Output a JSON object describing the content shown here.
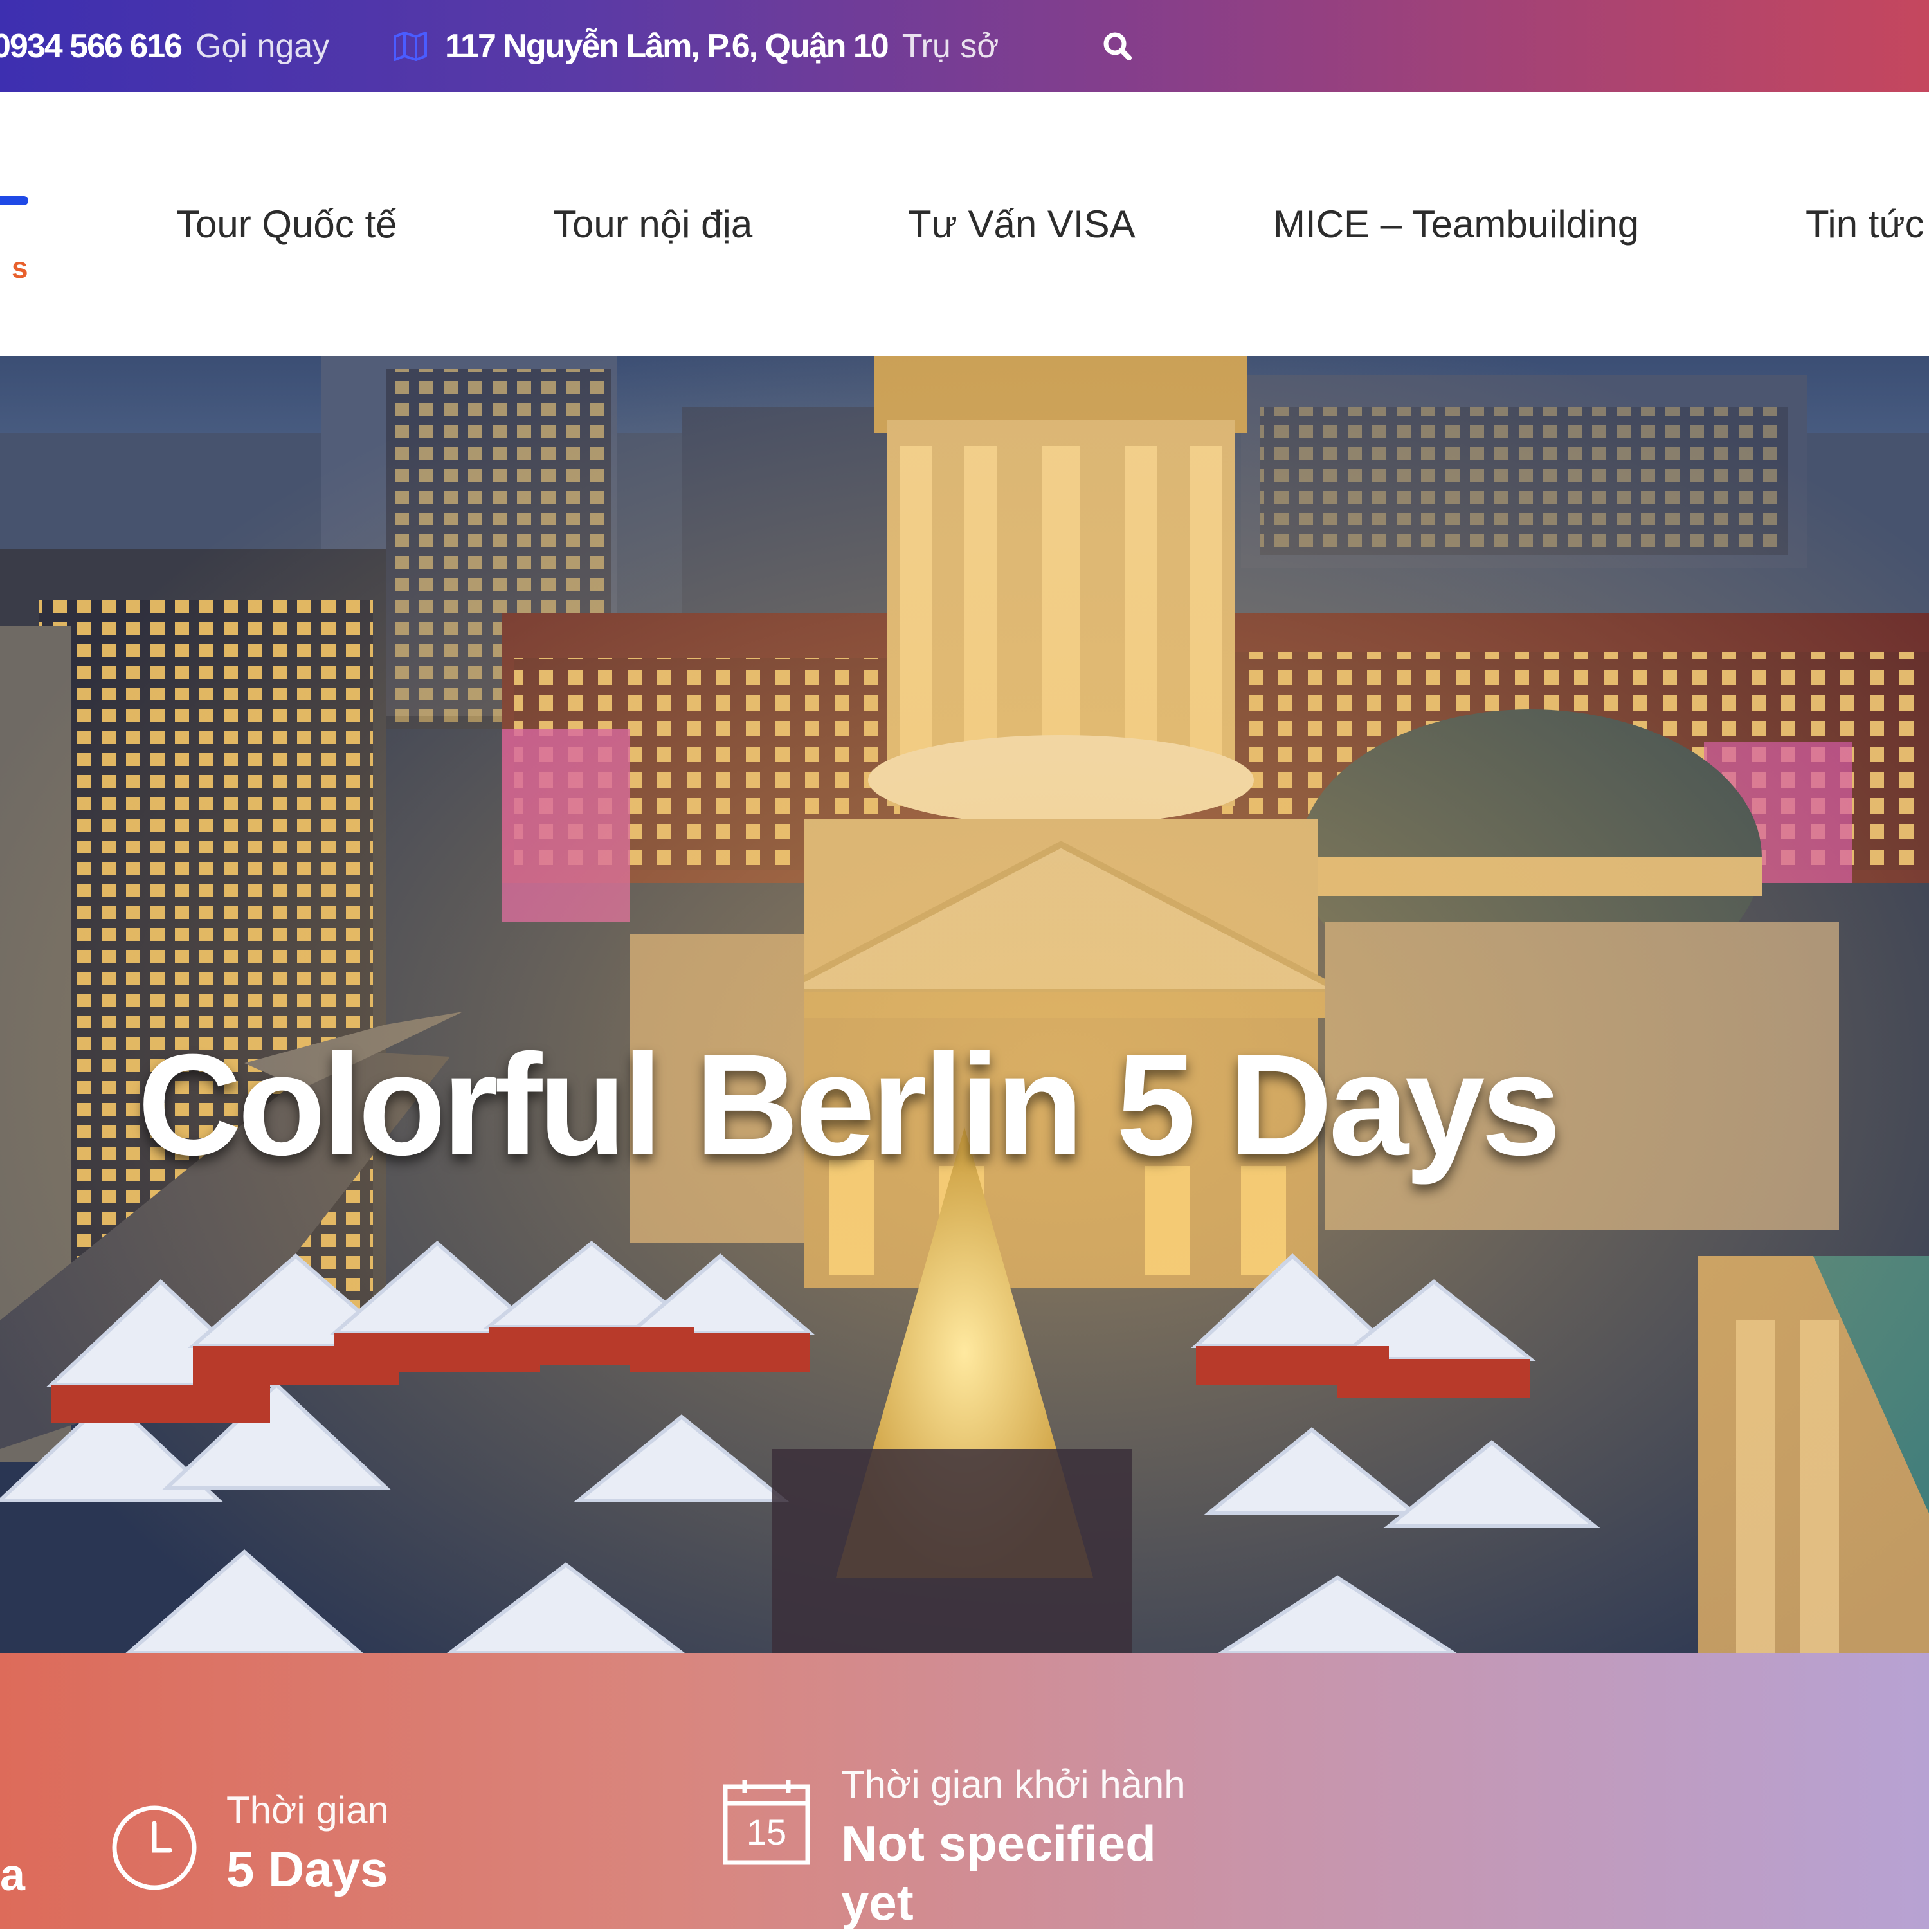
{
  "topbar": {
    "phone": "0934 566 616",
    "phone_action": "Gọi ngay",
    "address": "117 Nguyễn Lâm, P.6, Quận 10",
    "address_label": "Trụ sở"
  },
  "nav": {
    "logo_fragment": "s",
    "items": [
      {
        "label": "Tour Quốc tế"
      },
      {
        "label": "Tour nội địa"
      },
      {
        "label": "Tư Vấn VISA"
      },
      {
        "label": "MICE – Teambuilding"
      },
      {
        "label": "Tin tức"
      }
    ]
  },
  "hero": {
    "title": "Colorful Berlin 5 Days"
  },
  "info": {
    "edge_glyph": "a",
    "duration_label": "Thời gian",
    "duration_value": "5 Days",
    "calendar_day": "15",
    "departure_label": "Thời gian khởi hành",
    "departure_value_line1": "Not specified",
    "departure_value_line2": "yet"
  },
  "colors": {
    "topbar_start": "#3d2fb0",
    "topbar_end": "#c5475e",
    "logo_blue": "#1f49e6",
    "logo_orange": "#e8602c",
    "info_start": "#dd6b5a",
    "info_end": "#b7a2d3"
  }
}
